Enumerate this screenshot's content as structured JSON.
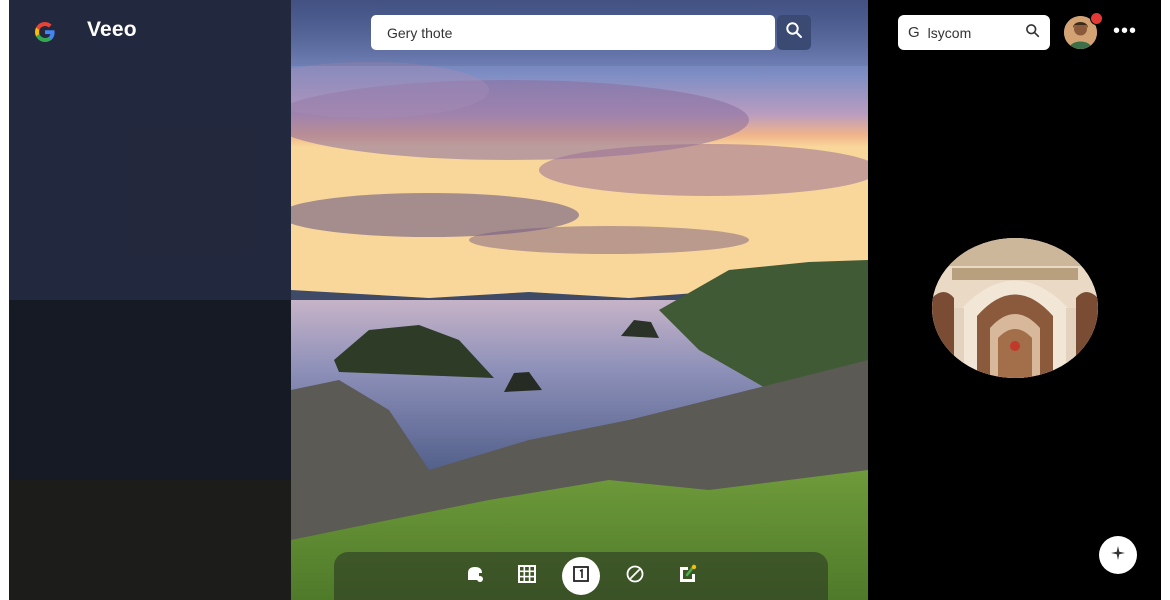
{
  "app": {
    "name": "Veeo",
    "logo_icon": "google-g-logo"
  },
  "search": {
    "value": "Gery thote",
    "icon": "search-icon"
  },
  "account_search": {
    "prefix": "G",
    "value": "lsycom",
    "icon": "search-icon"
  },
  "header": {
    "more_label": "••• ",
    "notification_color": "#e53935"
  },
  "toolbar": {
    "items": [
      {
        "icon": "shape-tool-icon"
      },
      {
        "icon": "grid-icon"
      },
      {
        "icon": "frame-icon",
        "active": true
      },
      {
        "icon": "brush-icon"
      },
      {
        "icon": "export-icon"
      }
    ]
  },
  "fab": {
    "icon": "sparkle-icon"
  },
  "colors": {
    "accent_button": "#3a4a73",
    "panel_bg": "#000000"
  }
}
